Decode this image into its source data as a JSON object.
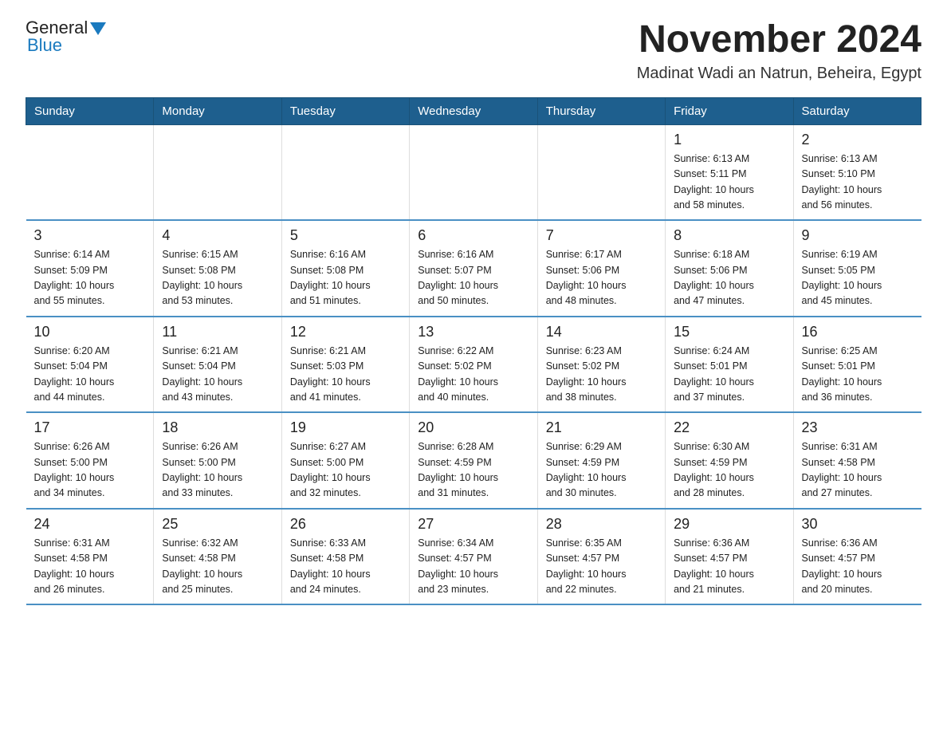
{
  "logo": {
    "general": "General",
    "blue": "Blue"
  },
  "title": "November 2024",
  "subtitle": "Madinat Wadi an Natrun, Beheira, Egypt",
  "days_of_week": [
    "Sunday",
    "Monday",
    "Tuesday",
    "Wednesday",
    "Thursday",
    "Friday",
    "Saturday"
  ],
  "weeks": [
    [
      {
        "day": "",
        "info": ""
      },
      {
        "day": "",
        "info": ""
      },
      {
        "day": "",
        "info": ""
      },
      {
        "day": "",
        "info": ""
      },
      {
        "day": "",
        "info": ""
      },
      {
        "day": "1",
        "info": "Sunrise: 6:13 AM\nSunset: 5:11 PM\nDaylight: 10 hours\nand 58 minutes."
      },
      {
        "day": "2",
        "info": "Sunrise: 6:13 AM\nSunset: 5:10 PM\nDaylight: 10 hours\nand 56 minutes."
      }
    ],
    [
      {
        "day": "3",
        "info": "Sunrise: 6:14 AM\nSunset: 5:09 PM\nDaylight: 10 hours\nand 55 minutes."
      },
      {
        "day": "4",
        "info": "Sunrise: 6:15 AM\nSunset: 5:08 PM\nDaylight: 10 hours\nand 53 minutes."
      },
      {
        "day": "5",
        "info": "Sunrise: 6:16 AM\nSunset: 5:08 PM\nDaylight: 10 hours\nand 51 minutes."
      },
      {
        "day": "6",
        "info": "Sunrise: 6:16 AM\nSunset: 5:07 PM\nDaylight: 10 hours\nand 50 minutes."
      },
      {
        "day": "7",
        "info": "Sunrise: 6:17 AM\nSunset: 5:06 PM\nDaylight: 10 hours\nand 48 minutes."
      },
      {
        "day": "8",
        "info": "Sunrise: 6:18 AM\nSunset: 5:06 PM\nDaylight: 10 hours\nand 47 minutes."
      },
      {
        "day": "9",
        "info": "Sunrise: 6:19 AM\nSunset: 5:05 PM\nDaylight: 10 hours\nand 45 minutes."
      }
    ],
    [
      {
        "day": "10",
        "info": "Sunrise: 6:20 AM\nSunset: 5:04 PM\nDaylight: 10 hours\nand 44 minutes."
      },
      {
        "day": "11",
        "info": "Sunrise: 6:21 AM\nSunset: 5:04 PM\nDaylight: 10 hours\nand 43 minutes."
      },
      {
        "day": "12",
        "info": "Sunrise: 6:21 AM\nSunset: 5:03 PM\nDaylight: 10 hours\nand 41 minutes."
      },
      {
        "day": "13",
        "info": "Sunrise: 6:22 AM\nSunset: 5:02 PM\nDaylight: 10 hours\nand 40 minutes."
      },
      {
        "day": "14",
        "info": "Sunrise: 6:23 AM\nSunset: 5:02 PM\nDaylight: 10 hours\nand 38 minutes."
      },
      {
        "day": "15",
        "info": "Sunrise: 6:24 AM\nSunset: 5:01 PM\nDaylight: 10 hours\nand 37 minutes."
      },
      {
        "day": "16",
        "info": "Sunrise: 6:25 AM\nSunset: 5:01 PM\nDaylight: 10 hours\nand 36 minutes."
      }
    ],
    [
      {
        "day": "17",
        "info": "Sunrise: 6:26 AM\nSunset: 5:00 PM\nDaylight: 10 hours\nand 34 minutes."
      },
      {
        "day": "18",
        "info": "Sunrise: 6:26 AM\nSunset: 5:00 PM\nDaylight: 10 hours\nand 33 minutes."
      },
      {
        "day": "19",
        "info": "Sunrise: 6:27 AM\nSunset: 5:00 PM\nDaylight: 10 hours\nand 32 minutes."
      },
      {
        "day": "20",
        "info": "Sunrise: 6:28 AM\nSunset: 4:59 PM\nDaylight: 10 hours\nand 31 minutes."
      },
      {
        "day": "21",
        "info": "Sunrise: 6:29 AM\nSunset: 4:59 PM\nDaylight: 10 hours\nand 30 minutes."
      },
      {
        "day": "22",
        "info": "Sunrise: 6:30 AM\nSunset: 4:59 PM\nDaylight: 10 hours\nand 28 minutes."
      },
      {
        "day": "23",
        "info": "Sunrise: 6:31 AM\nSunset: 4:58 PM\nDaylight: 10 hours\nand 27 minutes."
      }
    ],
    [
      {
        "day": "24",
        "info": "Sunrise: 6:31 AM\nSunset: 4:58 PM\nDaylight: 10 hours\nand 26 minutes."
      },
      {
        "day": "25",
        "info": "Sunrise: 6:32 AM\nSunset: 4:58 PM\nDaylight: 10 hours\nand 25 minutes."
      },
      {
        "day": "26",
        "info": "Sunrise: 6:33 AM\nSunset: 4:58 PM\nDaylight: 10 hours\nand 24 minutes."
      },
      {
        "day": "27",
        "info": "Sunrise: 6:34 AM\nSunset: 4:57 PM\nDaylight: 10 hours\nand 23 minutes."
      },
      {
        "day": "28",
        "info": "Sunrise: 6:35 AM\nSunset: 4:57 PM\nDaylight: 10 hours\nand 22 minutes."
      },
      {
        "day": "29",
        "info": "Sunrise: 6:36 AM\nSunset: 4:57 PM\nDaylight: 10 hours\nand 21 minutes."
      },
      {
        "day": "30",
        "info": "Sunrise: 6:36 AM\nSunset: 4:57 PM\nDaylight: 10 hours\nand 20 minutes."
      }
    ]
  ]
}
